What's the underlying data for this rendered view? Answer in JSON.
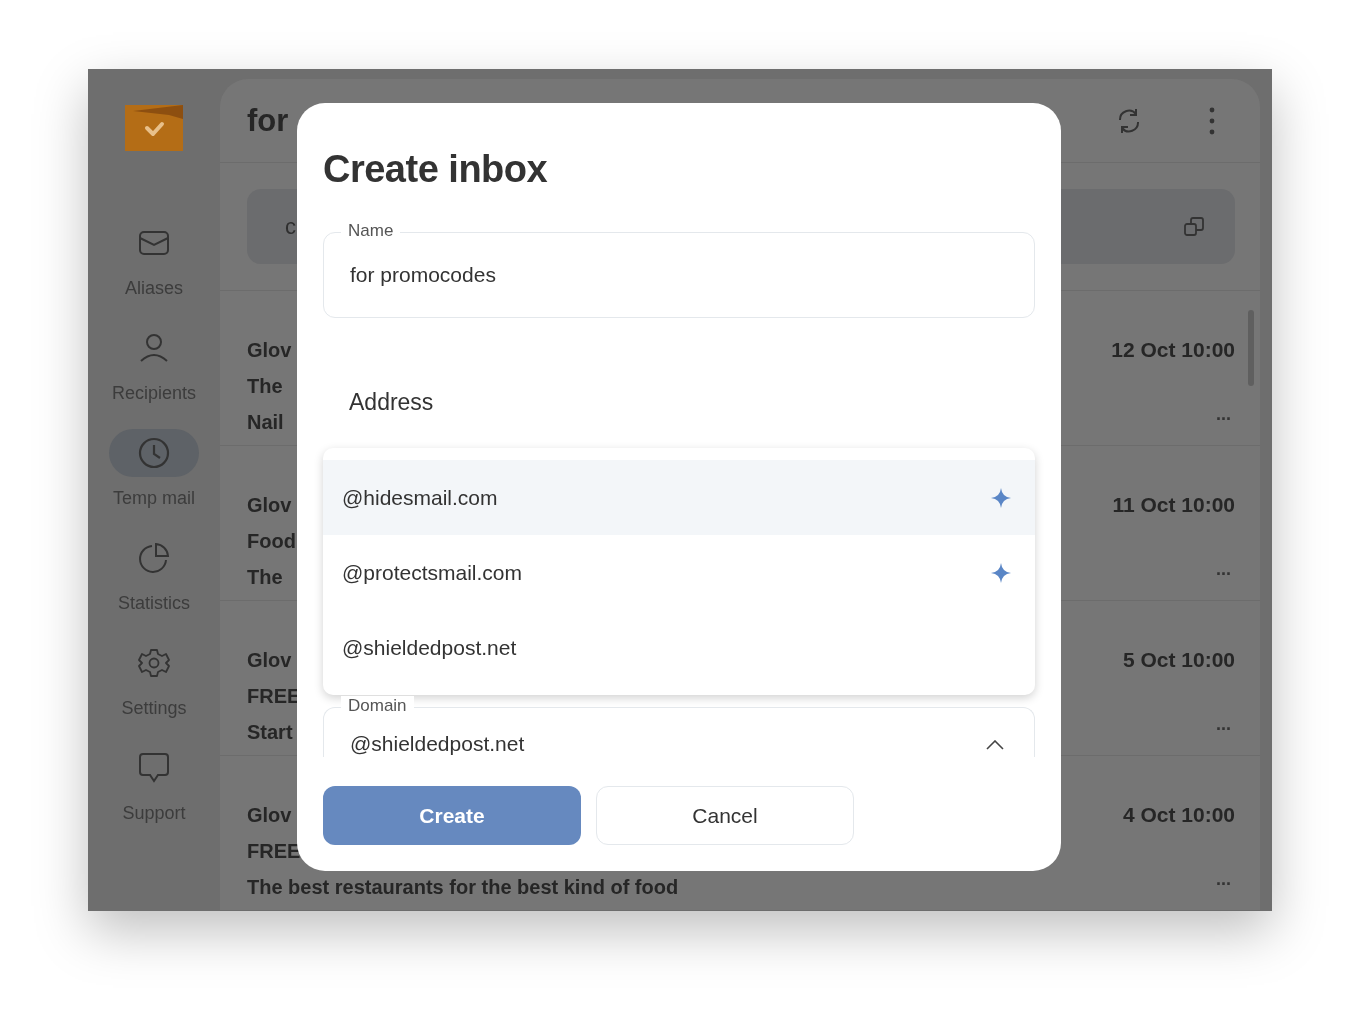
{
  "sidebar": {
    "items": [
      {
        "label": "Aliases",
        "kind": "mail",
        "selected": false
      },
      {
        "label": "Recipients",
        "kind": "person",
        "selected": false
      },
      {
        "label": "Temp mail",
        "kind": "clock",
        "selected": true
      },
      {
        "label": "Statistics",
        "kind": "pie",
        "selected": false
      },
      {
        "label": "Settings",
        "kind": "gear",
        "selected": false
      },
      {
        "label": "Support",
        "kind": "chat",
        "selected": false
      }
    ]
  },
  "header": {
    "title": "for"
  },
  "address_bar": {
    "text": "c"
  },
  "messages": [
    {
      "sender": "Glov",
      "subject": "The",
      "preview": "Nail",
      "date": "12 Oct 10:00",
      "more": "..."
    },
    {
      "sender": "Glov",
      "subject": "Food",
      "preview": "The",
      "date": "11 Oct 10:00",
      "more": "..."
    },
    {
      "sender": "Glov",
      "subject": "FREE",
      "preview": "Start",
      "date": "5 Oct 10:00",
      "more": "..."
    },
    {
      "sender": "Glov",
      "subject": "FREE",
      "preview": "The best restaurants for the best kind of food",
      "date": "4 Oct 10:00",
      "more": "..."
    }
  ],
  "dialog": {
    "title": "Create inbox",
    "name_field": {
      "label": "Name",
      "value": "for promocodes"
    },
    "address_heading": "Address",
    "domain_options": [
      {
        "label": "@hidesmail.com",
        "starred": true,
        "selected": true
      },
      {
        "label": "@protectsmail.com",
        "starred": true,
        "selected": false
      },
      {
        "label": "@shieldedpost.net",
        "starred": false,
        "selected": false
      }
    ],
    "domain_field": {
      "label": "Domain",
      "value": "@shieldedpost.net",
      "expanded": true
    },
    "buttons": [
      {
        "label": "Create",
        "kind": "primary"
      },
      {
        "label": "Cancel",
        "kind": "secondary"
      }
    ]
  }
}
